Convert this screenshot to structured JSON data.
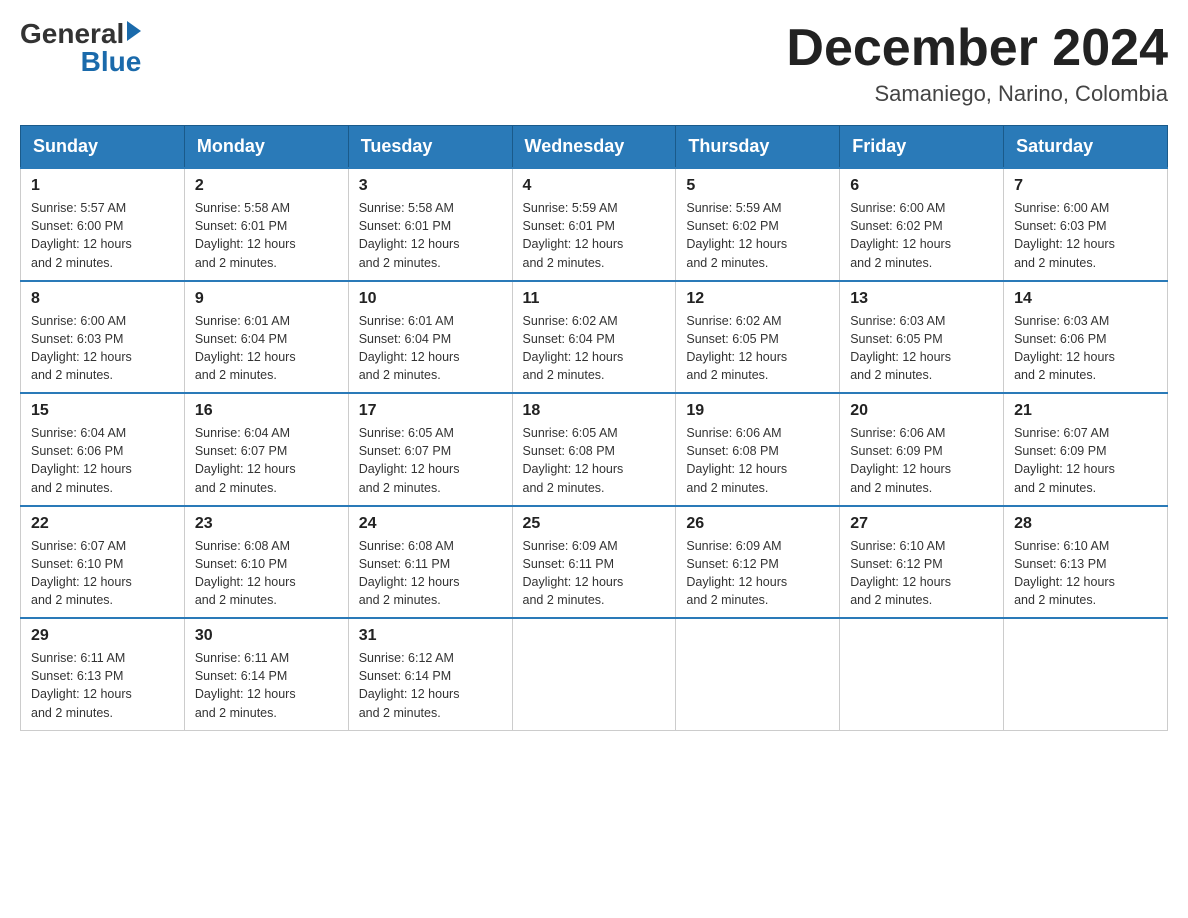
{
  "logo": {
    "general": "General",
    "blue": "Blue",
    "arrow": "▶"
  },
  "title": "December 2024",
  "subtitle": "Samaniego, Narino, Colombia",
  "days_of_week": [
    "Sunday",
    "Monday",
    "Tuesday",
    "Wednesday",
    "Thursday",
    "Friday",
    "Saturday"
  ],
  "weeks": [
    [
      {
        "day": "1",
        "sunrise": "5:57 AM",
        "sunset": "6:00 PM",
        "daylight": "12 hours and 2 minutes."
      },
      {
        "day": "2",
        "sunrise": "5:58 AM",
        "sunset": "6:01 PM",
        "daylight": "12 hours and 2 minutes."
      },
      {
        "day": "3",
        "sunrise": "5:58 AM",
        "sunset": "6:01 PM",
        "daylight": "12 hours and 2 minutes."
      },
      {
        "day": "4",
        "sunrise": "5:59 AM",
        "sunset": "6:01 PM",
        "daylight": "12 hours and 2 minutes."
      },
      {
        "day": "5",
        "sunrise": "5:59 AM",
        "sunset": "6:02 PM",
        "daylight": "12 hours and 2 minutes."
      },
      {
        "day": "6",
        "sunrise": "6:00 AM",
        "sunset": "6:02 PM",
        "daylight": "12 hours and 2 minutes."
      },
      {
        "day": "7",
        "sunrise": "6:00 AM",
        "sunset": "6:03 PM",
        "daylight": "12 hours and 2 minutes."
      }
    ],
    [
      {
        "day": "8",
        "sunrise": "6:00 AM",
        "sunset": "6:03 PM",
        "daylight": "12 hours and 2 minutes."
      },
      {
        "day": "9",
        "sunrise": "6:01 AM",
        "sunset": "6:04 PM",
        "daylight": "12 hours and 2 minutes."
      },
      {
        "day": "10",
        "sunrise": "6:01 AM",
        "sunset": "6:04 PM",
        "daylight": "12 hours and 2 minutes."
      },
      {
        "day": "11",
        "sunrise": "6:02 AM",
        "sunset": "6:04 PM",
        "daylight": "12 hours and 2 minutes."
      },
      {
        "day": "12",
        "sunrise": "6:02 AM",
        "sunset": "6:05 PM",
        "daylight": "12 hours and 2 minutes."
      },
      {
        "day": "13",
        "sunrise": "6:03 AM",
        "sunset": "6:05 PM",
        "daylight": "12 hours and 2 minutes."
      },
      {
        "day": "14",
        "sunrise": "6:03 AM",
        "sunset": "6:06 PM",
        "daylight": "12 hours and 2 minutes."
      }
    ],
    [
      {
        "day": "15",
        "sunrise": "6:04 AM",
        "sunset": "6:06 PM",
        "daylight": "12 hours and 2 minutes."
      },
      {
        "day": "16",
        "sunrise": "6:04 AM",
        "sunset": "6:07 PM",
        "daylight": "12 hours and 2 minutes."
      },
      {
        "day": "17",
        "sunrise": "6:05 AM",
        "sunset": "6:07 PM",
        "daylight": "12 hours and 2 minutes."
      },
      {
        "day": "18",
        "sunrise": "6:05 AM",
        "sunset": "6:08 PM",
        "daylight": "12 hours and 2 minutes."
      },
      {
        "day": "19",
        "sunrise": "6:06 AM",
        "sunset": "6:08 PM",
        "daylight": "12 hours and 2 minutes."
      },
      {
        "day": "20",
        "sunrise": "6:06 AM",
        "sunset": "6:09 PM",
        "daylight": "12 hours and 2 minutes."
      },
      {
        "day": "21",
        "sunrise": "6:07 AM",
        "sunset": "6:09 PM",
        "daylight": "12 hours and 2 minutes."
      }
    ],
    [
      {
        "day": "22",
        "sunrise": "6:07 AM",
        "sunset": "6:10 PM",
        "daylight": "12 hours and 2 minutes."
      },
      {
        "day": "23",
        "sunrise": "6:08 AM",
        "sunset": "6:10 PM",
        "daylight": "12 hours and 2 minutes."
      },
      {
        "day": "24",
        "sunrise": "6:08 AM",
        "sunset": "6:11 PM",
        "daylight": "12 hours and 2 minutes."
      },
      {
        "day": "25",
        "sunrise": "6:09 AM",
        "sunset": "6:11 PM",
        "daylight": "12 hours and 2 minutes."
      },
      {
        "day": "26",
        "sunrise": "6:09 AM",
        "sunset": "6:12 PM",
        "daylight": "12 hours and 2 minutes."
      },
      {
        "day": "27",
        "sunrise": "6:10 AM",
        "sunset": "6:12 PM",
        "daylight": "12 hours and 2 minutes."
      },
      {
        "day": "28",
        "sunrise": "6:10 AM",
        "sunset": "6:13 PM",
        "daylight": "12 hours and 2 minutes."
      }
    ],
    [
      {
        "day": "29",
        "sunrise": "6:11 AM",
        "sunset": "6:13 PM",
        "daylight": "12 hours and 2 minutes."
      },
      {
        "day": "30",
        "sunrise": "6:11 AM",
        "sunset": "6:14 PM",
        "daylight": "12 hours and 2 minutes."
      },
      {
        "day": "31",
        "sunrise": "6:12 AM",
        "sunset": "6:14 PM",
        "daylight": "12 hours and 2 minutes."
      },
      null,
      null,
      null,
      null
    ]
  ],
  "labels": {
    "sunrise": "Sunrise:",
    "sunset": "Sunset:",
    "daylight": "Daylight:"
  }
}
